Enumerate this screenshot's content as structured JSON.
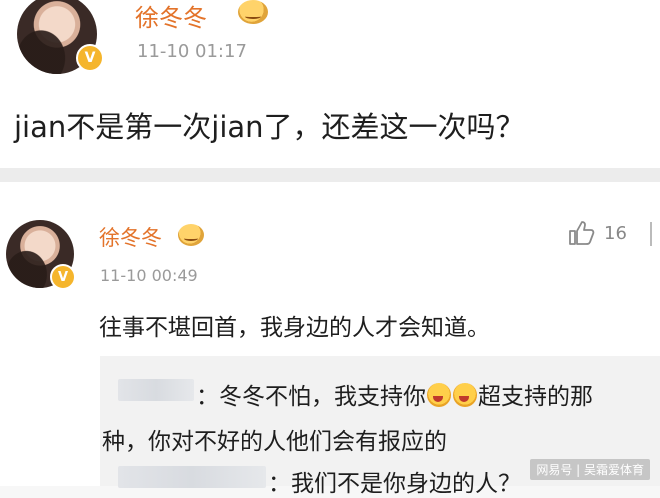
{
  "post_main": {
    "username": "徐冬冬",
    "time": "11-10 01:17",
    "content": "jian不是第一次jian了，还差这一次吗？",
    "badge_icon": "v-verified-icon"
  },
  "post_reply": {
    "username": "徐冬冬",
    "time": "11-10 00:49",
    "content": "往事不堪回首，我身边的人才会知道。",
    "likes": "16",
    "sub_replies": [
      {
        "sep": "：",
        "line1": "冬冬不怕，我支持你",
        "line1_after": "超支持的那",
        "line2": "种，你对不好的人他们会有报应的"
      },
      {
        "sep": "：",
        "line1": "我们不是你身边的人？"
      }
    ]
  },
  "watermark": "网易号 | 吴霜爱体育",
  "colors": {
    "username": "#e3732a",
    "time": "#9a9a9a",
    "badge": "#f5b52c"
  }
}
